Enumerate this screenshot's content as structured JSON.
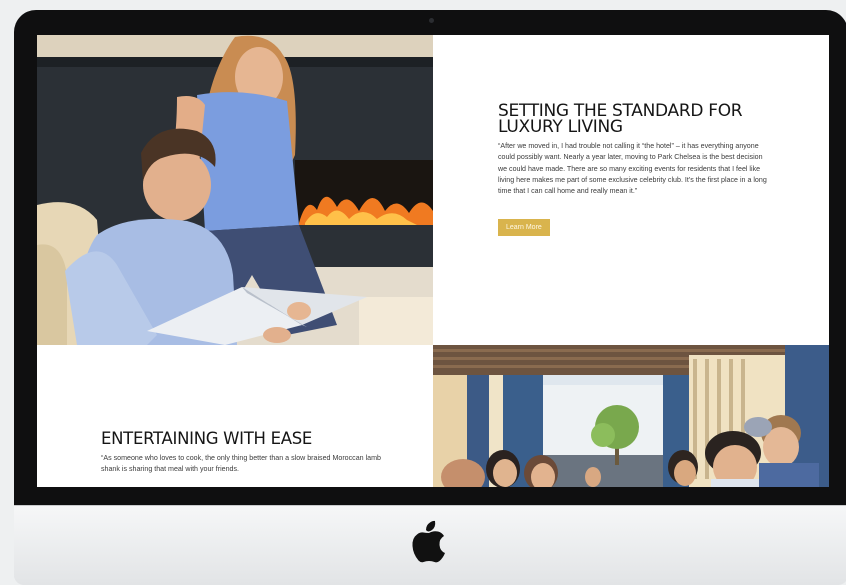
{
  "window": {
    "device": "iMac",
    "brand_mark": "apple-logo"
  },
  "section_luxury": {
    "title": "SETTING THE STANDARD FOR LUXURY LIVING",
    "quote": "“After we moved in, I had trouble not calling it “the hotel” – it has everything anyone could possibly want. Nearly a year later, moving to Park Chelsea is the best decision we could have made. There are so many exciting events for residents that I feel like living here makes me part of some exclusive celebrity club. It’s the first place in a long time that I can call home and really mean it.”",
    "button_label": "Learn More"
  },
  "section_ease": {
    "title": "ENTERTAINING WITH EASE",
    "quote": "“As someone who loves to cook, the only thing better than a slow braised Moroccan lamb shank is sharing that meal with your friends."
  },
  "images": {
    "top_left": "couple-reading-by-fireplace",
    "bottom_right": "friends-dining-on-patio"
  },
  "colors": {
    "accent": "#d9b44d",
    "heading": "#151515",
    "body_text": "#3b3b3b",
    "bezel": "#0f0f10"
  }
}
